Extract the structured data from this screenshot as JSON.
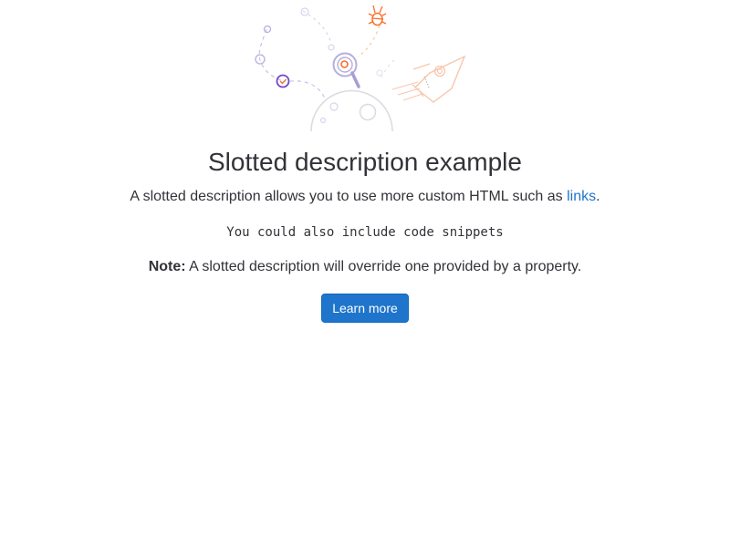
{
  "empty_state": {
    "title": "Slotted description example",
    "description_line1_before_link": "A slotted description allows you to use more custom HTML such as ",
    "description_link": "links",
    "description_line1_after_link": ".",
    "code_snippet": "You could also include code snippets",
    "note_label": "Note:",
    "note_text": " A slotted description will override one provided by a property.",
    "primary_button_label": "Learn more"
  },
  "colors": {
    "accent_blue": "#1f75cb",
    "text": "#333238",
    "illustration_purple": "#6e49cb",
    "illustration_orange": "#fc6d26"
  }
}
